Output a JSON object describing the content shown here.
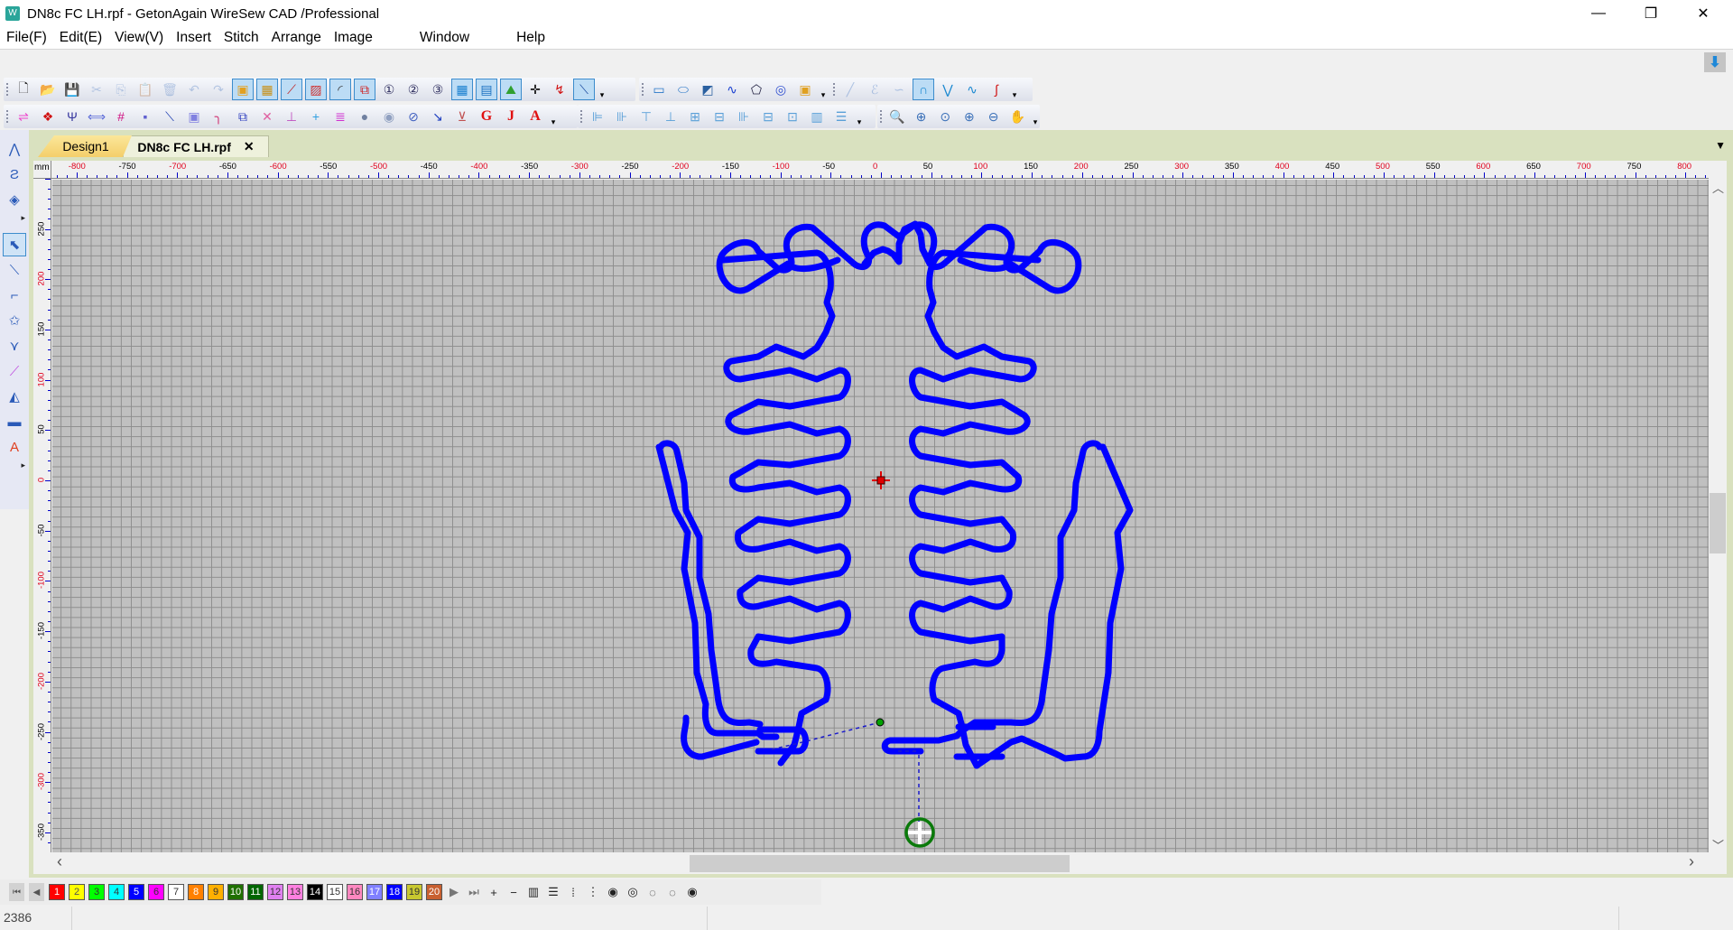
{
  "window": {
    "title": "DN8c FC LH.rpf - GetonAgain WireSew CAD /Professional",
    "controls": {
      "minimize": "—",
      "restore": "❐",
      "close": "✕"
    }
  },
  "menu": [
    "File(F)",
    "Edit(E)",
    "View(V)",
    "Insert",
    "Stitch",
    "Arrange",
    "Image",
    "Window",
    "Help"
  ],
  "toolbar1": [
    {
      "name": "new-file",
      "glyph": "🗋",
      "state": "normal"
    },
    {
      "name": "open-folder",
      "glyph": "📂",
      "state": "normal"
    },
    {
      "name": "save",
      "glyph": "💾",
      "state": "normal"
    },
    {
      "name": "cut",
      "glyph": "✂",
      "state": "disabled"
    },
    {
      "name": "copy",
      "glyph": "⎘",
      "state": "disabled"
    },
    {
      "name": "paste",
      "glyph": "📋",
      "state": "disabled"
    },
    {
      "name": "delete",
      "glyph": "🗑",
      "state": "disabled"
    },
    {
      "name": "undo",
      "glyph": "↶",
      "state": "disabled"
    },
    {
      "name": "redo",
      "glyph": "↷",
      "state": "disabled"
    },
    {
      "name": "show-background",
      "glyph": "▣",
      "state": "selected"
    },
    {
      "name": "show-pattern",
      "glyph": "▦",
      "state": "selected"
    },
    {
      "name": "show-stitch-points",
      "glyph": "⟋",
      "state": "selected"
    },
    {
      "name": "show-fill",
      "glyph": "▨",
      "state": "selected"
    },
    {
      "name": "show-outline",
      "glyph": "◜",
      "state": "selected"
    },
    {
      "name": "show-connectors",
      "glyph": "⧉",
      "state": "selected"
    },
    {
      "name": "head-1",
      "glyph": "①",
      "state": "normal"
    },
    {
      "name": "head-2",
      "glyph": "②",
      "state": "normal"
    },
    {
      "name": "head-3",
      "glyph": "③",
      "state": "normal"
    },
    {
      "name": "grid",
      "glyph": "▦",
      "state": "selected"
    },
    {
      "name": "ruler",
      "glyph": "▤",
      "state": "selected"
    },
    {
      "name": "image",
      "glyph": "⛰",
      "state": "selected"
    },
    {
      "name": "move-origin",
      "glyph": "✛",
      "state": "normal"
    },
    {
      "name": "start-point",
      "glyph": "↯",
      "state": "normal"
    },
    {
      "name": "connect",
      "glyph": "⟍",
      "state": "selected"
    }
  ],
  "toolbar1b": [
    {
      "name": "rectangle",
      "glyph": "▭"
    },
    {
      "name": "ellipse",
      "glyph": "⬭"
    },
    {
      "name": "polygon-shape",
      "glyph": "◩"
    },
    {
      "name": "wave",
      "glyph": "∿"
    },
    {
      "name": "pentagon",
      "glyph": "⬠"
    },
    {
      "name": "spiral",
      "glyph": "◎"
    },
    {
      "name": "pattern-fill",
      "glyph": "▣"
    }
  ],
  "toolbar1c": [
    {
      "name": "line",
      "glyph": "╱",
      "state": "disabled"
    },
    {
      "name": "curve",
      "glyph": "ℰ",
      "state": "disabled"
    },
    {
      "name": "s-curve",
      "glyph": "∽",
      "state": "disabled"
    },
    {
      "name": "arch",
      "glyph": "∩",
      "state": "selected"
    },
    {
      "name": "zigzag",
      "glyph": "⋁",
      "state": "normal"
    },
    {
      "name": "sine",
      "glyph": "∿",
      "state": "normal"
    },
    {
      "name": "double-sine",
      "glyph": "∫",
      "state": "normal"
    }
  ],
  "toolbar2": [
    {
      "name": "reverse",
      "glyph": "⇌"
    },
    {
      "name": "fill-red",
      "glyph": "❖"
    },
    {
      "name": "fork",
      "glyph": "Ψ"
    },
    {
      "name": "mirror-horizontal",
      "glyph": "⟺"
    },
    {
      "name": "grid-stitch",
      "glyph": "#"
    },
    {
      "name": "delete-point",
      "glyph": "▪"
    },
    {
      "name": "cut-line",
      "glyph": "⟍"
    },
    {
      "name": "frame",
      "glyph": "▣"
    },
    {
      "name": "arc",
      "glyph": "╮"
    },
    {
      "name": "node-link",
      "glyph": "⧉"
    },
    {
      "name": "split",
      "glyph": "✕"
    },
    {
      "name": "join",
      "glyph": "⊥"
    },
    {
      "name": "add-point",
      "glyph": "+"
    },
    {
      "name": "sequence",
      "glyph": "≣"
    },
    {
      "name": "remove-hole",
      "glyph": "●"
    },
    {
      "name": "circle-point",
      "glyph": "◉"
    },
    {
      "name": "measure",
      "glyph": "⊘"
    },
    {
      "name": "vector",
      "glyph": "↘"
    },
    {
      "name": "base-point",
      "glyph": "⊻"
    },
    {
      "name": "text-g",
      "glyph": "G"
    },
    {
      "name": "text-j",
      "glyph": "J"
    },
    {
      "name": "text-a",
      "glyph": "A"
    }
  ],
  "toolbar2b": [
    {
      "name": "align-left",
      "glyph": "⊫"
    },
    {
      "name": "align-right",
      "glyph": "⊪"
    },
    {
      "name": "align-top",
      "glyph": "⊤"
    },
    {
      "name": "align-bottom",
      "glyph": "⊥"
    },
    {
      "name": "align-center-h",
      "glyph": "⊞"
    },
    {
      "name": "align-center-v",
      "glyph": "⊟"
    },
    {
      "name": "distribute-h",
      "glyph": "⊪"
    },
    {
      "name": "distribute-v",
      "glyph": "⊟"
    },
    {
      "name": "center-page",
      "glyph": "⊡"
    },
    {
      "name": "same-width",
      "glyph": "▥"
    },
    {
      "name": "same-height",
      "glyph": "☰"
    }
  ],
  "toolbar2c": [
    {
      "name": "zoom-actual",
      "glyph": "🔍"
    },
    {
      "name": "zoom-window",
      "glyph": "⊕"
    },
    {
      "name": "zoom-fit",
      "glyph": "⊙"
    },
    {
      "name": "zoom-in",
      "glyph": "⊕"
    },
    {
      "name": "zoom-out",
      "glyph": "⊖"
    },
    {
      "name": "pan-hand",
      "glyph": "✋"
    }
  ],
  "left_tools_top": [
    {
      "name": "polyline-tool",
      "glyph": "⋀"
    },
    {
      "name": "curve-tool",
      "glyph": "Ƨ"
    },
    {
      "name": "fill-tool",
      "glyph": "◈"
    }
  ],
  "left_tools": [
    {
      "name": "select-tool",
      "glyph": "⬉",
      "selected": true
    },
    {
      "name": "edit-line-tool",
      "glyph": "⟍"
    },
    {
      "name": "edit-path-tool",
      "glyph": "⌐"
    },
    {
      "name": "edit-star-tool",
      "glyph": "✩"
    },
    {
      "name": "node-tool",
      "glyph": "⋎"
    },
    {
      "name": "knife-tool",
      "glyph": "⟋"
    },
    {
      "name": "transform-tool",
      "glyph": "◭"
    },
    {
      "name": "ruler-tool",
      "glyph": "▬"
    },
    {
      "name": "text-tool",
      "glyph": "A"
    }
  ],
  "tabs": [
    {
      "label": "Design1",
      "active": false
    },
    {
      "label": "DN8c FC LH.rpf",
      "active": true,
      "close": "✕"
    }
  ],
  "ruler": {
    "unit": "mm",
    "x_labels": [
      -800,
      -750,
      -700,
      -650,
      -600,
      -550,
      -500,
      -450,
      -400,
      -350,
      -300,
      -250,
      -200,
      -150,
      -100,
      -50,
      0,
      50,
      100,
      150,
      200,
      250,
      300,
      350,
      400,
      450,
      500,
      550,
      600,
      650,
      700,
      750,
      800
    ],
    "y_labels": [
      250,
      200,
      150,
      100,
      50,
      0,
      -50,
      -100,
      -150,
      -200,
      -250,
      -300,
      -350
    ],
    "highlight_color": "#e0001c",
    "normal_color": "#000000",
    "tick_color": "#0000c8"
  },
  "design": {
    "stitch_color": "#0000ff",
    "jump_color": "#1a1acc",
    "start_marker_color": "#00a000",
    "end_marker_color": "#0a7a0a",
    "origin_marker_color": "#e00000"
  },
  "color_palette": [
    {
      "n": "1",
      "c": "#ff0000",
      "t": "#ffffff"
    },
    {
      "n": "2",
      "c": "#ffff00",
      "t": "#555555"
    },
    {
      "n": "3",
      "c": "#00ff00",
      "t": "#333333"
    },
    {
      "n": "4",
      "c": "#00ffff",
      "t": "#333333"
    },
    {
      "n": "5",
      "c": "#0000ff",
      "t": "#ffffff"
    },
    {
      "n": "6",
      "c": "#ff00ff",
      "t": "#333333"
    },
    {
      "n": "7",
      "c": "#ffffff",
      "t": "#333333"
    },
    {
      "n": "8",
      "c": "#ff8000",
      "t": "#ffffff"
    },
    {
      "n": "9",
      "c": "#ffb000",
      "t": "#333333"
    },
    {
      "n": "10",
      "c": "#207000",
      "t": "#ffffff"
    },
    {
      "n": "11",
      "c": "#006600",
      "t": "#ffffff"
    },
    {
      "n": "12",
      "c": "#e080f0",
      "t": "#333333"
    },
    {
      "n": "13",
      "c": "#ff80e0",
      "t": "#333333"
    },
    {
      "n": "14",
      "c": "#000000",
      "t": "#ffffff"
    },
    {
      "n": "15",
      "c": "#ffffff",
      "t": "#333333"
    },
    {
      "n": "16",
      "c": "#ff88c0",
      "t": "#333333"
    },
    {
      "n": "17",
      "c": "#8080ff",
      "t": "#ffffff"
    },
    {
      "n": "18",
      "c": "#0000ff",
      "t": "#ffffff"
    },
    {
      "n": "19",
      "c": "#c8c830",
      "t": "#333333"
    },
    {
      "n": "20",
      "c": "#c86030",
      "t": "#ffffff"
    }
  ],
  "palette_tools": [
    {
      "name": "next-color",
      "glyph": "▶"
    },
    {
      "name": "last-color",
      "glyph": "⏭"
    },
    {
      "name": "add-color",
      "glyph": "+"
    },
    {
      "name": "remove-color",
      "glyph": "−"
    },
    {
      "name": "color-bars",
      "glyph": "▥"
    },
    {
      "name": "color-list",
      "glyph": "☰"
    },
    {
      "name": "layout-grid",
      "glyph": "⁞"
    },
    {
      "name": "layout-tree",
      "glyph": "⋮"
    },
    {
      "name": "view-eye",
      "glyph": "◉"
    },
    {
      "name": "view-eye-2",
      "glyph": "◎"
    },
    {
      "name": "view-eye-3",
      "glyph": "◌"
    },
    {
      "name": "view-eye-4",
      "glyph": "◌"
    },
    {
      "name": "view-eye-5",
      "glyph": "◉"
    }
  ],
  "palette_nav": {
    "first": "⏮",
    "prev": "◀"
  },
  "status": {
    "stitch_count": "2386"
  },
  "download_glyph": "⬇",
  "tab_menu_glyph": "▼",
  "scroll": {
    "up": "︿",
    "down": "﹀",
    "left": "‹",
    "right": "›",
    "vertical_position_fraction": 0.47,
    "horizontal_position_fraction": 0.5
  }
}
